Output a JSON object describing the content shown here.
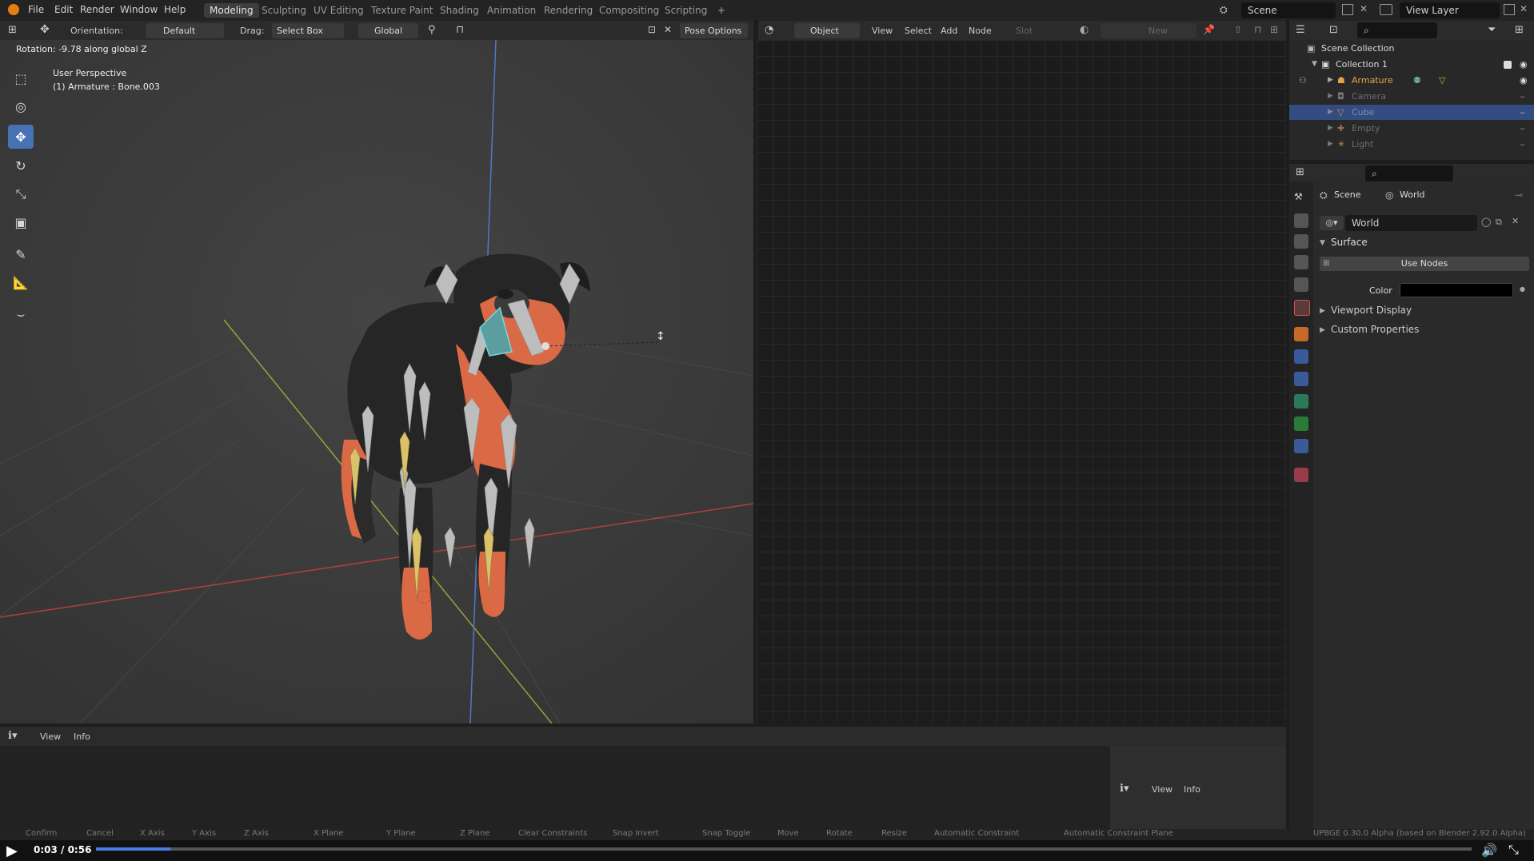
{
  "menu": {
    "file": "File",
    "edit": "Edit",
    "render": "Render",
    "window": "Window",
    "help": "Help"
  },
  "workspaces": [
    "Modeling",
    "Sculpting",
    "UV Editing",
    "Texture Paint",
    "Shading",
    "Animation",
    "Rendering",
    "Compositing",
    "Scripting"
  ],
  "add_workspace": "+",
  "scene_field": "Scene",
  "view_layer_field": "View Layer",
  "viewport_header": {
    "orientation_label": "Orientation:",
    "orientation_value": "Default",
    "drag_label": "Drag:",
    "drag_value": "Select Box",
    "transform_value": "Global",
    "pose_options": "Pose Options"
  },
  "viewport": {
    "rotation_status": "Rotation: -9.78 along global Z",
    "perspective": "User Perspective",
    "active_object": "(1) Armature : Bone.003"
  },
  "node_header": {
    "mode": "Object",
    "view": "View",
    "select": "Select",
    "add": "Add",
    "node": "Node",
    "slot": "Slot",
    "new": "New"
  },
  "outliner": {
    "scene_collection": "Scene Collection",
    "collection": "Collection 1",
    "items": [
      {
        "label": "Armature",
        "color": "#e8a44a"
      },
      {
        "label": "Camera",
        "color": "#6e6e6e"
      },
      {
        "label": "Cube",
        "color": "#7a8fb8"
      },
      {
        "label": "Empty",
        "color": "#6e6e6e"
      },
      {
        "label": "Light",
        "color": "#6e6e6e"
      }
    ]
  },
  "properties": {
    "breadcrumb_scene": "Scene",
    "breadcrumb_world": "World",
    "world_name": "World",
    "surface_panel": "Surface",
    "use_nodes": "Use Nodes",
    "color_label": "Color",
    "color_value": "#000000",
    "viewport_display": "Viewport Display",
    "custom_properties": "Custom Properties"
  },
  "info_editor": {
    "view": "View",
    "info": "Info",
    "view2": "View",
    "info2": "Info"
  },
  "status_bar": {
    "items": [
      "Confirm",
      "Cancel",
      "X Axis",
      "Y Axis",
      "Z Axis",
      "X Plane",
      "Y Plane",
      "Z Plane",
      "Clear Constraints",
      "Snap Invert",
      "Snap Toggle",
      "Move",
      "Rotate",
      "Resize",
      "Automatic Constraint",
      "Automatic Constraint Plane"
    ],
    "version": "UPBGE 0.30.0 Alpha (based on Blender 2.92.0 Alpha)"
  },
  "video": {
    "time": "0:03 / 0:56",
    "progress": 0.054
  },
  "colors": {
    "accent": "#4772b3",
    "dog_orange": "#d96a45",
    "dog_black": "#252525"
  }
}
